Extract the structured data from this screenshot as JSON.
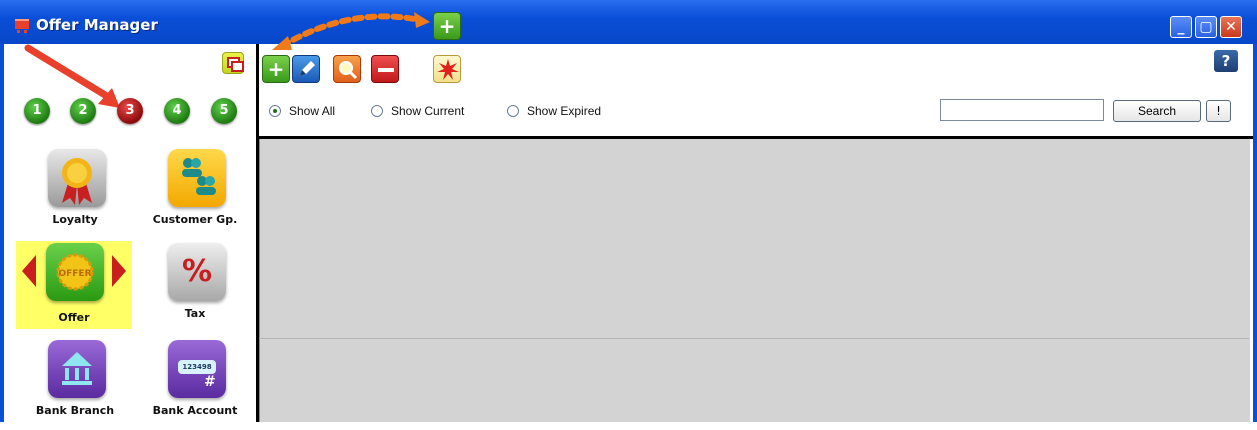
{
  "window": {
    "title": "Offer Manager"
  },
  "pages": [
    "1",
    "2",
    "3",
    "4",
    "5"
  ],
  "tiles": [
    {
      "label": "Loyalty"
    },
    {
      "label": "Customer Gp."
    },
    {
      "label": "Offer"
    },
    {
      "label": "Tax"
    },
    {
      "label": "Bank Branch"
    },
    {
      "label": "Bank Account"
    }
  ],
  "toolbar": {
    "help": "?"
  },
  "filters": {
    "show_all": "Show All",
    "show_current": "Show Current",
    "show_expired": "Show Expired",
    "selected": "Show All"
  },
  "search": {
    "value": "",
    "button": "Search",
    "extra_button": "!"
  },
  "icons": {
    "offer_badge_text": "OFFER",
    "tax_symbol": "%",
    "account_number": "123498",
    "account_hash": "#"
  },
  "colors": {
    "title_bar": "#0a4fd8",
    "selected_tile": "#ffff66",
    "content_bg": "#d3d3d3"
  }
}
